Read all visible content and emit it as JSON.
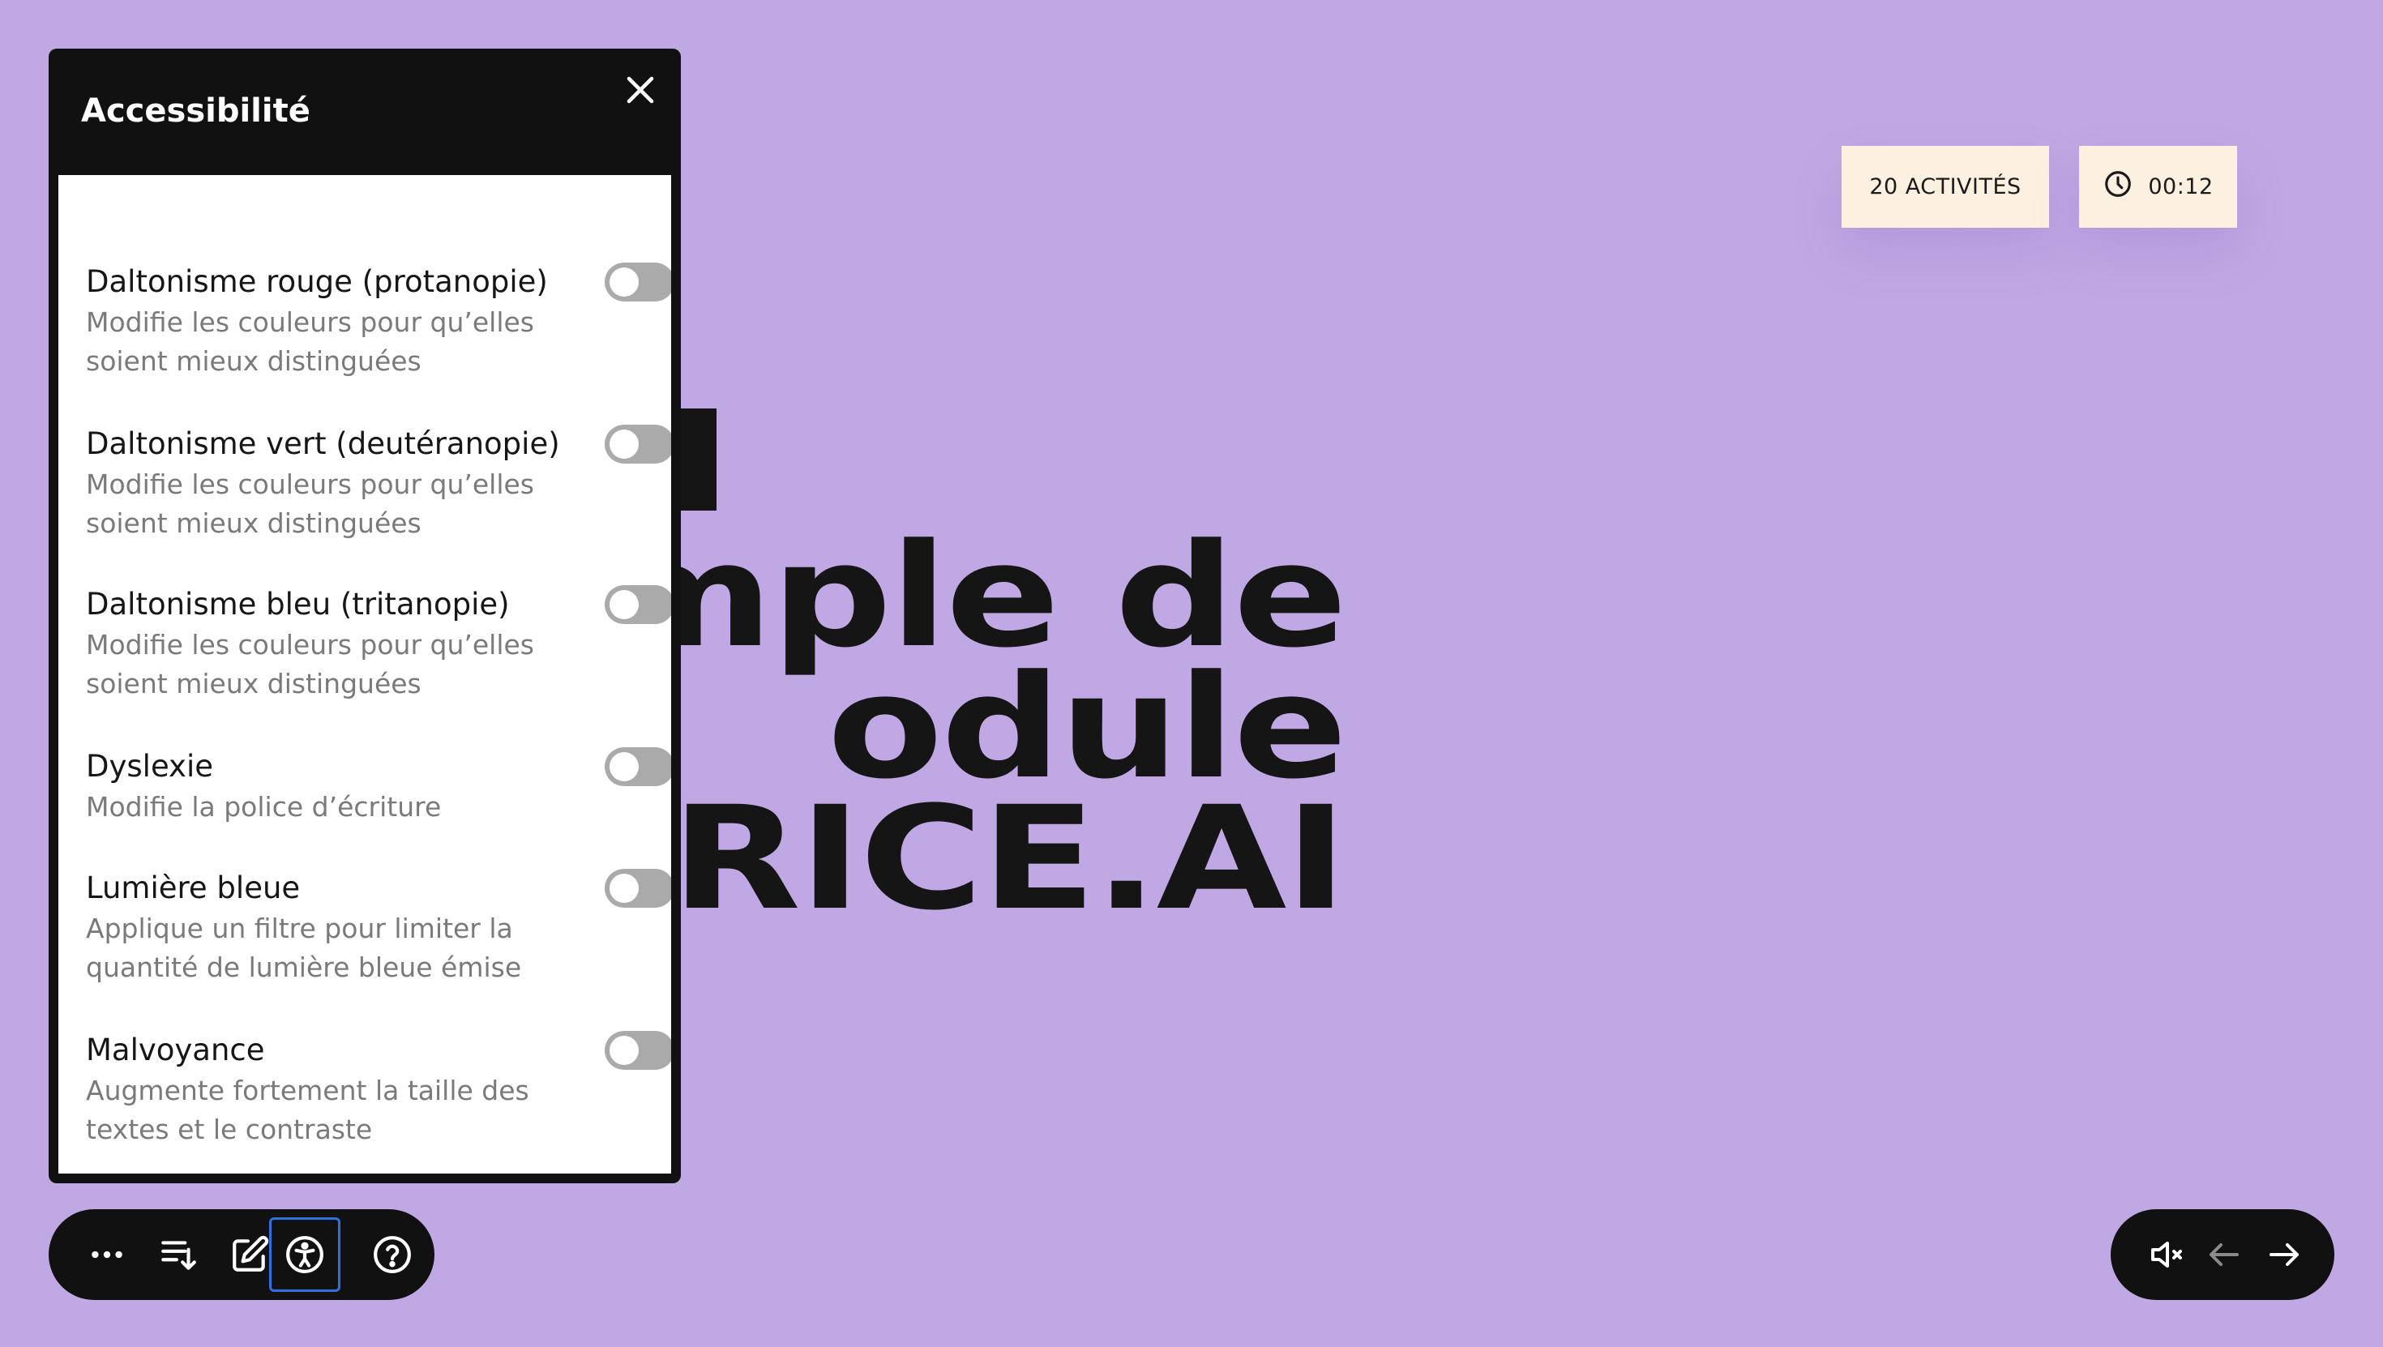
{
  "background": {
    "title_lines": [
      "emple de",
      "odule",
      "TRICE.AI"
    ]
  },
  "badges": {
    "activities": "20 ACTIVITÉS",
    "timer": "00:12"
  },
  "accessibility_panel": {
    "title": "Accessibilité",
    "options": [
      {
        "label": "Daltonisme rouge (protanopie)",
        "description": "Modifie les couleurs pour qu’elles soient mieux distinguées",
        "enabled": false
      },
      {
        "label": "Daltonisme vert (deutéranopie)",
        "description": "Modifie les couleurs pour qu’elles soient mieux distinguées",
        "enabled": false
      },
      {
        "label": "Daltonisme bleu (tritanopie)",
        "description": "Modifie les couleurs pour qu’elles soient mieux distinguées",
        "enabled": false
      },
      {
        "label": "Dyslexie",
        "description": "Modifie la police d’écriture",
        "enabled": false
      },
      {
        "label": "Lumière bleue",
        "description": "Applique un filtre pour limiter la quantité de lumière bleue émise",
        "enabled": false
      },
      {
        "label": "Malvoyance",
        "description": "Augmente fortement la taille des textes et le contraste",
        "enabled": false
      }
    ]
  },
  "toolbar": {
    "tools": [
      "more-icon",
      "playlist-icon",
      "edit-icon",
      "accessibility-icon",
      "help-icon"
    ],
    "active_tool": "accessibility-icon"
  },
  "navigation": {
    "icons": [
      "mute-icon",
      "arrow-left-icon",
      "arrow-right-icon"
    ]
  },
  "colors": {
    "background": "#c0a8e4",
    "panel": "#111111",
    "badge": "#fcf0e0",
    "toggle_off": "#aaaaaa",
    "active_outline": "#2f6fe0"
  }
}
